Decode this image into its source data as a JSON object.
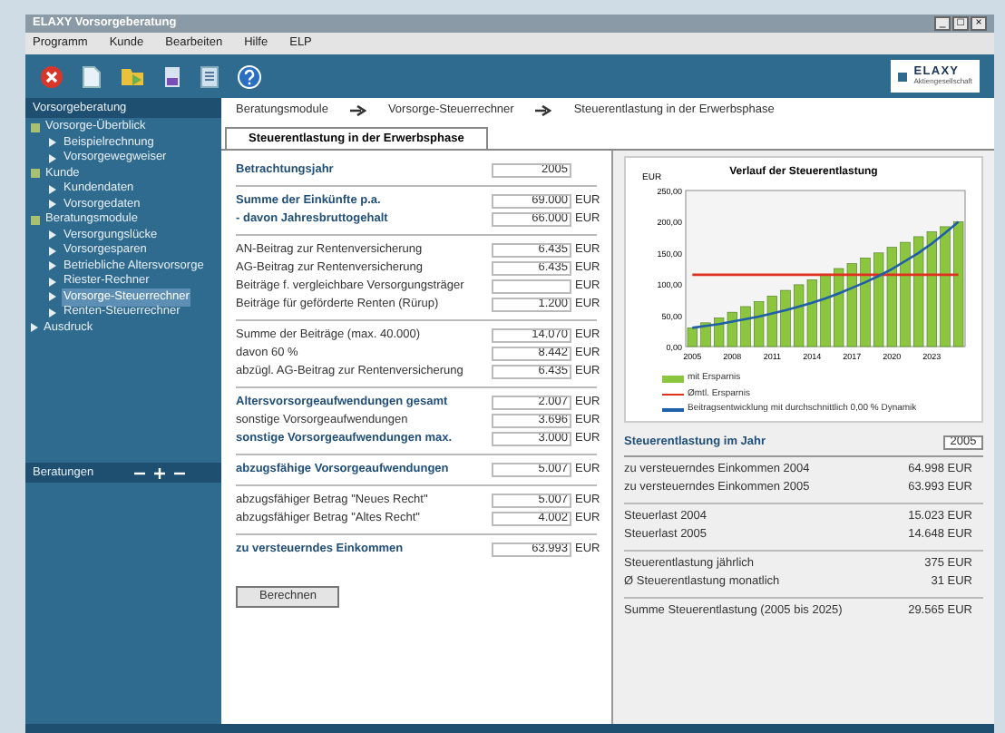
{
  "window": {
    "title": "ELAXY Vorsorgeberatung",
    "controls": [
      "_",
      "□",
      "×"
    ]
  },
  "menu": [
    "Programm",
    "Kunde",
    "Bearbeiten",
    "Hilfe",
    "ELP"
  ],
  "logo": {
    "text": "ELAXY",
    "subtitle": "Aktiengesellschaft"
  },
  "sidebar": {
    "title": "Vorsorgeberatung",
    "tree": [
      {
        "label": "Vorsorge-Überblick",
        "expanded": true,
        "selected": false,
        "children": [
          {
            "label": "Beispielrechnung",
            "selected": false
          },
          {
            "label": "Vorsorgewegweiser",
            "selected": false
          }
        ]
      },
      {
        "label": "Kunde",
        "expanded": true,
        "selected": false,
        "children": [
          {
            "label": "Kundendaten",
            "selected": false
          },
          {
            "label": "Vorsorgedaten",
            "selected": false
          }
        ]
      },
      {
        "label": "Beratungsmodule",
        "expanded": true,
        "selected": false,
        "children": [
          {
            "label": "Versorgungslücke",
            "selected": false
          },
          {
            "label": "Vorsorgesparen",
            "selected": false
          },
          {
            "label": "Betriebliche Altersvorsorge",
            "selected": false
          },
          {
            "label": "Riester-Rechner",
            "selected": false
          },
          {
            "label": "Vorsorge-Steuerrechner",
            "selected": true
          },
          {
            "label": "Renten-Steuerrechner",
            "selected": false
          }
        ]
      },
      {
        "label": "Ausdruck",
        "selected": false
      }
    ],
    "bottom_title": "Beratungen"
  },
  "breadcrumb": [
    "Beratungsmodule",
    "Vorsorge-Steuerrechner",
    "Steuerentlastung in der Erwerbsphase"
  ],
  "tabs": [
    {
      "label": "Steuerentlastung in der Erwerbsphase",
      "selected": true
    }
  ],
  "form": {
    "groups": [
      [
        {
          "label": "Betrachtungsjahr",
          "value": "2005",
          "emphasis": true
        }
      ],
      [
        {
          "label": "Summe der Einkünfte p.a.",
          "value": "69.000",
          "unit": "EUR",
          "emphasis": true
        },
        {
          "label": "- davon Jahresbruttogehalt",
          "value": "66.000",
          "unit": "EUR",
          "emphasis": true
        }
      ],
      [
        {
          "label": "AN-Beitrag zur Rentenversicherung",
          "value": "6.435",
          "unit": "EUR",
          "emphasis": false
        },
        {
          "label": "AG-Beitrag zur Rentenversicherung",
          "value": "6.435",
          "unit": "EUR",
          "emphasis": false
        },
        {
          "label": "Beiträge f. vergleichbare Versorgungsträger",
          "unit": "EUR",
          "emphasis": false
        },
        {
          "label": "Beiträge für geförderte Renten (Rürup)",
          "value": "1.200",
          "unit": "EUR",
          "emphasis": false
        }
      ],
      [
        {
          "label": "Summe der Beiträge (max. 40.000)",
          "value": "14.070",
          "unit": "EUR",
          "emphasis": false
        },
        {
          "label": "davon 60 %",
          "value": "8.442",
          "unit": "EUR",
          "emphasis": false
        },
        {
          "label": "abzügl. AG-Beitrag zur Rentenversicherung",
          "value": "6.435",
          "unit": "EUR",
          "emphasis": false
        }
      ],
      [
        {
          "label": "Altersvorsorgeaufwendungen gesamt",
          "value": "2.007",
          "unit": "EUR",
          "emphasis": true
        },
        {
          "label": "sonstige Vorsorgeaufwendungen",
          "value": "3.696",
          "unit": "EUR",
          "emphasis": false
        },
        {
          "label": "sonstige Vorsorgeaufwendungen max.",
          "value": "3.000",
          "unit": "EUR",
          "emphasis": true
        }
      ],
      [
        {
          "label": "abzugsfähige Vorsorgeaufwendungen",
          "value": "5.007",
          "unit": "EUR",
          "emphasis": true
        }
      ],
      [
        {
          "label": "abzugsfähiger Betrag \"Neues Recht\"",
          "value": "5.007",
          "unit": "EUR",
          "emphasis": false
        },
        {
          "label": "abzugsfähiger Betrag \"Altes Recht\"",
          "value": "4.002",
          "unit": "EUR",
          "emphasis": false
        }
      ],
      [
        {
          "label": "zu versteuerndes Einkommen",
          "value": "63.993",
          "unit": "EUR",
          "emphasis": true
        }
      ]
    ],
    "button": "Berechnen"
  },
  "chart_data": {
    "type": "bar",
    "title": "Verlauf der Steuerentlastung",
    "ylabel": "EUR",
    "x": [
      2005,
      2006,
      2007,
      2008,
      2009,
      2010,
      2011,
      2012,
      2013,
      2014,
      2015,
      2016,
      2017,
      2018,
      2019,
      2020,
      2021,
      2022,
      2023,
      2024,
      2025
    ],
    "xlim": [
      2004.5,
      2025.5
    ],
    "ylim": [
      0,
      250
    ],
    "legend": "bottom",
    "yticks": [
      {
        "value": 0,
        "label": "0,00"
      },
      {
        "value": 50,
        "label": "50,00"
      },
      {
        "value": 100,
        "label": "100,00"
      },
      {
        "value": 150,
        "label": "150,00"
      },
      {
        "value": 200,
        "label": "200,00"
      },
      {
        "value": 250,
        "label": "250,00"
      }
    ],
    "xticks": [
      2005,
      2008,
      2011,
      2014,
      2017,
      2020,
      2023
    ],
    "series": [
      {
        "name": "mit Ersparnis",
        "color": "#8cc63f",
        "values": [
          30,
          38,
          46,
          55,
          64,
          72,
          81,
          90,
          99,
          107,
          116,
          125,
          133,
          142,
          150,
          159,
          167,
          176,
          184,
          192,
          200
        ]
      },
      {
        "name": "Ømtl. Ersparnis",
        "type": "line",
        "color": "#e03020",
        "values": [
          115,
          115,
          115,
          115,
          115,
          115,
          115,
          115,
          115,
          115,
          115,
          115,
          115,
          115,
          115,
          115,
          115,
          115,
          115,
          115,
          115
        ]
      },
      {
        "name": "Beitragsentwicklung mit durchschnittlich 0,00 % Dynamik",
        "type": "line",
        "color": "#1f5fa8",
        "values": [
          30,
          33,
          36,
          40,
          44,
          48,
          53,
          58,
          64,
          70,
          77,
          85,
          94,
          103,
          113,
          124,
          137,
          150,
          165,
          182,
          200
        ]
      }
    ]
  },
  "results": {
    "year_label": "Steuerentlastung im Jahr",
    "year": "2005",
    "groups": [
      [
        {
          "label": "zu versteuerndes Einkommen 2004",
          "value": "64.998 EUR"
        },
        {
          "label": "zu versteuerndes Einkommen 2005",
          "value": "63.993 EUR"
        }
      ],
      [
        {
          "label": "Steuerlast 2004",
          "value": "15.023 EUR"
        },
        {
          "label": "Steuerlast 2005",
          "value": "14.648 EUR"
        }
      ],
      [
        {
          "label": "Steuerentlastung jährlich",
          "value": "375 EUR"
        },
        {
          "label": "Ø Steuerentlastung monatlich",
          "value": "31 EUR"
        }
      ],
      [
        {
          "label": "Summe Steuerentlastung (2005 bis 2025)",
          "value": "29.565 EUR"
        }
      ]
    ]
  }
}
